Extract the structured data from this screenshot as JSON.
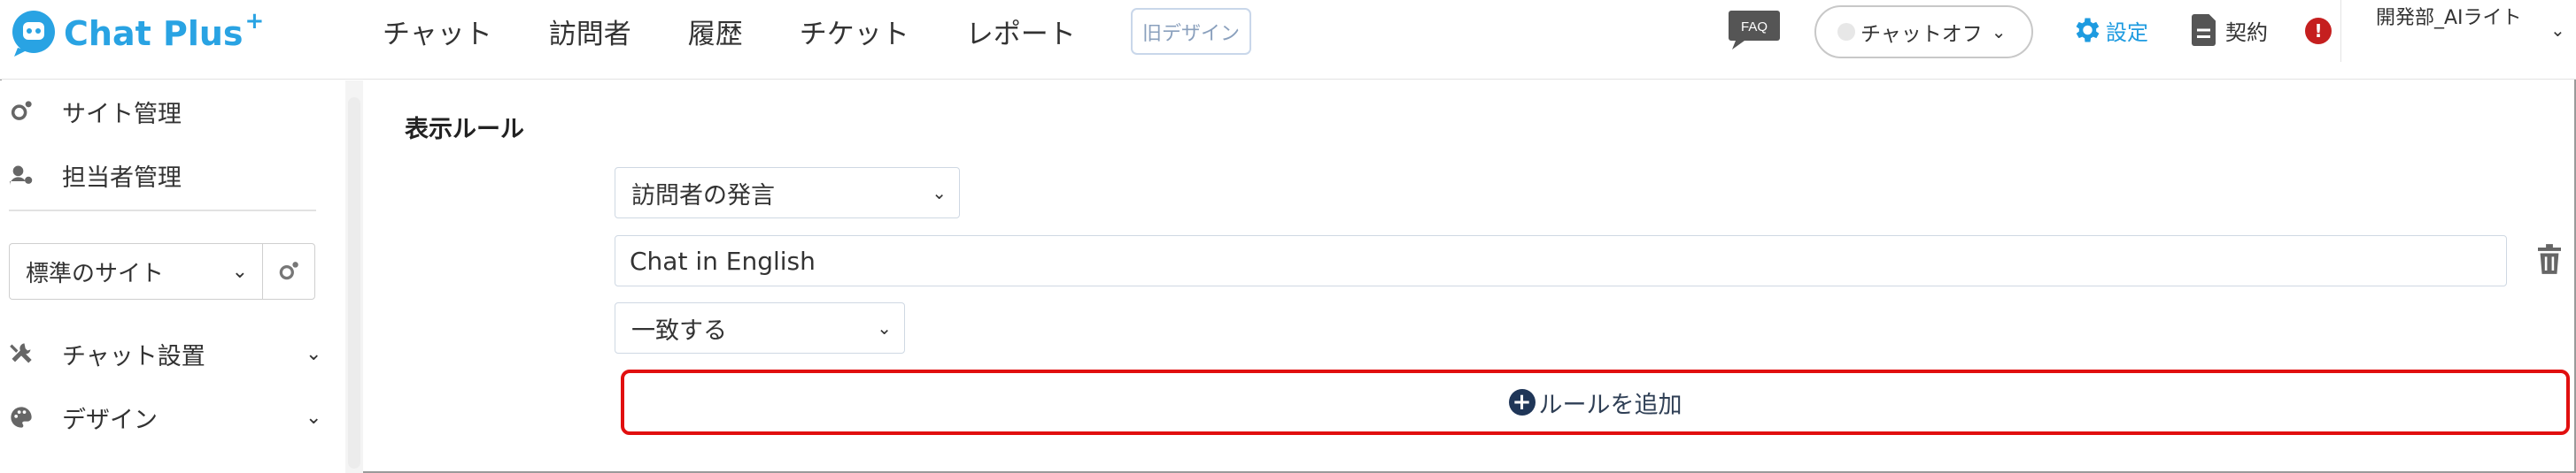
{
  "header": {
    "brand": "Chat Plus",
    "brand_plus": "+",
    "nav": [
      "チャット",
      "訪問者",
      "履歴",
      "チケット",
      "レポート"
    ],
    "old_design": "旧デザイン",
    "faq": "FAQ",
    "chat_status": "チャットオフ",
    "settings": "設定",
    "contract": "契約",
    "alert": "!",
    "user": "開発部_AIライト"
  },
  "sidebar": {
    "site_management": "サイト管理",
    "staff_management": "担当者管理",
    "site_select": "標準のサイト",
    "chat_install": "チャット設置",
    "design": "デザイン"
  },
  "main": {
    "section_title": "表示ルール",
    "condition_select": "訪問者の発言",
    "text_value": "Chat in English",
    "match_select": "一致する",
    "add_rule": "ルールを追加"
  },
  "colors": {
    "brand": "#29a3e3",
    "settings": "#1e9be0",
    "alert": "#c51f1f",
    "highlight": "#e10f0f",
    "add_icon": "#1f3658"
  }
}
